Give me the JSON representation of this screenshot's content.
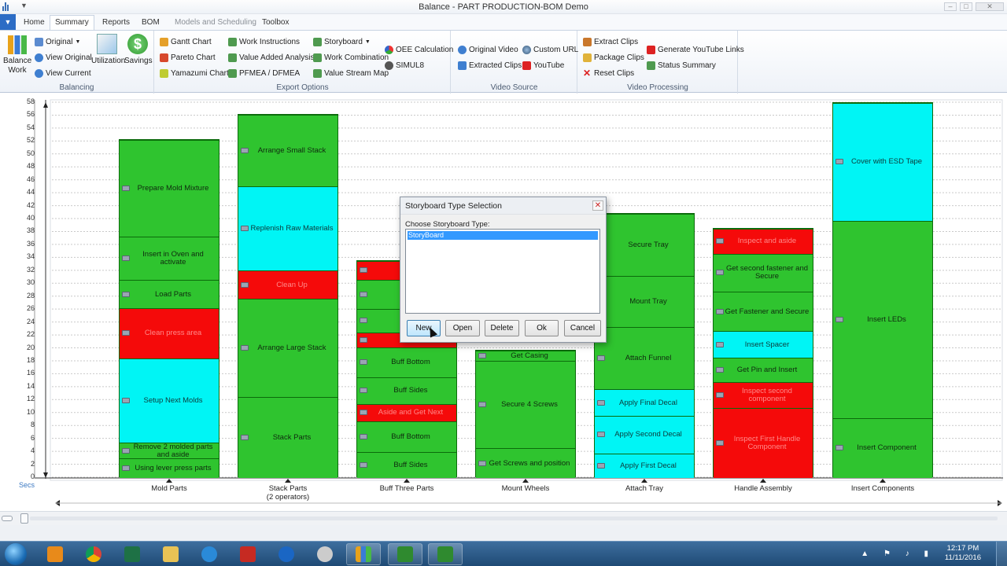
{
  "window": {
    "title": "Balance - PART PRODUCTION-BOM Demo",
    "qat_symbol": "▼",
    "controls": [
      "–",
      "□",
      "✕"
    ]
  },
  "menu_button_symbol": "▼",
  "tabs": [
    {
      "label": "Home",
      "state": "normal"
    },
    {
      "label": "Summary",
      "state": "active"
    },
    {
      "label": "Reports",
      "state": "normal"
    },
    {
      "label": "BOM",
      "state": "normal"
    },
    {
      "label": "Models and Scheduling",
      "state": "disabled"
    },
    {
      "label": "Toolbox",
      "state": "normal"
    }
  ],
  "ribbon": {
    "balancing": {
      "label": "Balancing",
      "balance_work": "Balance Work",
      "original": "Original",
      "view_original": "View Original",
      "view_current": "View Current",
      "utilization": "Utilization",
      "savings": "Savings"
    },
    "export": {
      "label": "Export Options",
      "gantt": "Gantt Chart",
      "pareto": "Pareto Chart",
      "yamazumi": "Yamazumi Chart",
      "work_instructions": "Work Instructions",
      "value_added": "Value Added Analysis",
      "pfmea": "PFMEA / DFMEA",
      "storyboard": "Storyboard",
      "work_combination": "Work Combination",
      "value_stream": "Value Stream Map",
      "oee": "OEE Calculation",
      "simul8": "SIMUL8"
    },
    "video_source": {
      "label": "Video Source",
      "original_video": "Original Video",
      "extracted_clips": "Extracted Clips",
      "custom_url": "Custom URL",
      "youtube": "YouTube"
    },
    "video_processing": {
      "label": "Video Processing",
      "extract_clips": "Extract Clips",
      "package_clips": "Package Clips",
      "reset_clips": "Reset Clips",
      "gen_youtube": "Generate YouTube Links",
      "status_summary": "Status Summary"
    }
  },
  "colors": {
    "green": "#2fc42f",
    "cyan": "#00f5f5",
    "red": "#f50a0a"
  },
  "chart_data": {
    "type": "bar",
    "stacked": true,
    "y_unit_label": "Secs",
    "ylim": [
      0,
      58
    ],
    "yticks": [
      0,
      2,
      4,
      6,
      8,
      10,
      12,
      14,
      16,
      18,
      20,
      22,
      24,
      26,
      28,
      30,
      32,
      34,
      36,
      38,
      40,
      42,
      44,
      46,
      48,
      50,
      52,
      54,
      56,
      58
    ],
    "categories": [
      {
        "label": "Mold Parts",
        "segments": [
          {
            "name": "Using lever press parts",
            "value": 3,
            "color": "green"
          },
          {
            "name": "Remove 2 molded parts and aside",
            "value": 2.5,
            "color": "green"
          },
          {
            "name": "Setup Next Molds",
            "value": 13,
            "color": "cyan"
          },
          {
            "name": "Clean press area",
            "value": 7.8,
            "color": "red"
          },
          {
            "name": "Load Parts",
            "value": 4.3,
            "color": "green"
          },
          {
            "name": "Insert in Oven and activate",
            "value": 6.7,
            "color": "green"
          },
          {
            "name": "Prepare Mold Mixture",
            "value": 15,
            "color": "green"
          }
        ]
      },
      {
        "label": "Stack Parts",
        "sublabel": "(2 operators)",
        "segments": [
          {
            "name": "Stack Parts",
            "value": 12.5,
            "color": "green"
          },
          {
            "name": "Arrange Large Stack",
            "value": 15.2,
            "color": "green"
          },
          {
            "name": "Clean Up",
            "value": 4.4,
            "color": "red"
          },
          {
            "name": "Replenish Raw Materials",
            "value": 13,
            "color": "cyan"
          },
          {
            "name": "Arrange Small Stack",
            "value": 11.1,
            "color": "green"
          }
        ]
      },
      {
        "label": "Buff Three Parts",
        "segments": [
          {
            "name": "Buff Sides",
            "value": 4,
            "color": "green"
          },
          {
            "name": "Buff Bottom",
            "value": 4.8,
            "color": "green"
          },
          {
            "name": "Aside and Get Next",
            "value": 2.6,
            "color": "red"
          },
          {
            "name": "Buff Sides",
            "value": 4.2,
            "color": "green"
          },
          {
            "name": "Buff Bottom",
            "value": 4.6,
            "color": "green"
          },
          {
            "name": "Aside",
            "value": 2.3,
            "color": "red"
          },
          {
            "name": "",
            "value": 3.7,
            "color": "green"
          },
          {
            "name": "",
            "value": 4.5,
            "color": "green"
          },
          {
            "name": "Aside",
            "value": 2.8,
            "color": "red"
          }
        ]
      },
      {
        "label": "Mount Wheels",
        "segments": [
          {
            "name": "Get Screws and position",
            "value": 4.6,
            "color": "green"
          },
          {
            "name": "Secure 4 Screws",
            "value": 13.5,
            "color": "green"
          },
          {
            "name": "Get Casing",
            "value": 1.6,
            "color": "green"
          }
        ]
      },
      {
        "label": "Attach Tray",
        "segments": [
          {
            "name": "Apply First Decal",
            "value": 3.8,
            "color": "cyan"
          },
          {
            "name": "Apply Second Decal",
            "value": 5.8,
            "color": "cyan"
          },
          {
            "name": "Apply Final Decal",
            "value": 4.1,
            "color": "cyan"
          },
          {
            "name": "Attach Funnel",
            "value": 9.6,
            "color": "green"
          },
          {
            "name": "Mount Tray",
            "value": 8,
            "color": "green"
          },
          {
            "name": "Secure Tray",
            "value": 9.5,
            "color": "green"
          }
        ]
      },
      {
        "label": "Handle Assembly",
        "segments": [
          {
            "name": "Inspect First Handle Component",
            "value": 10.8,
            "color": "red"
          },
          {
            "name": "Inspect second component",
            "value": 4,
            "color": "red"
          },
          {
            "name": "Get Pin and Insert",
            "value": 3.8,
            "color": "green"
          },
          {
            "name": "Insert Spacer",
            "value": 4.1,
            "color": "cyan"
          },
          {
            "name": "Get Fastener and Secure",
            "value": 6.1,
            "color": "green"
          },
          {
            "name": "Get second fastener and Secure",
            "value": 5.9,
            "color": "green"
          },
          {
            "name": "Inspect and aside",
            "value": 3.8,
            "color": "red"
          }
        ]
      },
      {
        "label": "Insert Components",
        "segments": [
          {
            "name": "Insert Component",
            "value": 9.3,
            "color": "green"
          },
          {
            "name": "Insert LEDs",
            "value": 30.5,
            "color": "green"
          },
          {
            "name": "Cover with ESD Tape",
            "value": 18.2,
            "color": "cyan"
          }
        ]
      }
    ]
  },
  "dialog": {
    "title": "Storyboard Type Selection",
    "close_symbol": "✕",
    "prompt": "Choose Storyboard Type:",
    "items": [
      "StoryBoard"
    ],
    "buttons": {
      "new": "New",
      "open": "Open",
      "delete": "Delete",
      "ok": "Ok",
      "cancel": "Cancel"
    }
  },
  "taskbar": {
    "time": "12:17 PM",
    "date": "11/11/2016",
    "tray_icons": "▲ ⚑ ♪ ▮"
  }
}
